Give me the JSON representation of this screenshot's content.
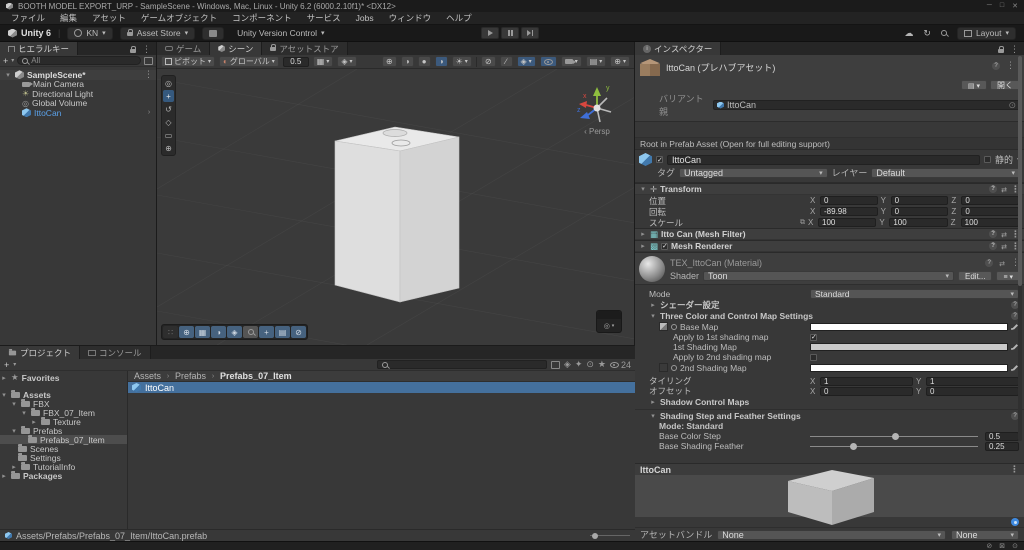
{
  "window": {
    "title": "BOOTH MODEL EXPORT_URP - SampleScene - Windows, Mac, Linux - Unity 6.2 (6000.2.10f1)* <DX12>",
    "menus": [
      "ファイル",
      "編集",
      "アセット",
      "ゲームオブジェクト",
      "コンポーネント",
      "サービス",
      "Jobs",
      "ウィンドウ",
      "ヘルプ"
    ]
  },
  "toolbar": {
    "unity_version": "Unity 6",
    "account": "KN",
    "asset_store": "Asset Store",
    "version_control": "Unity Version Control",
    "layout": "Layout"
  },
  "hierarchy": {
    "tab": "ヒエラルキー",
    "search_placeholder": "All",
    "scene_name": "SampleScene*",
    "items": [
      {
        "label": "Main Camera"
      },
      {
        "label": "Directional Light"
      },
      {
        "label": "Global Volume"
      },
      {
        "label": "IttoCan"
      }
    ]
  },
  "scene": {
    "tab_game": "ゲーム",
    "tab_scene": "シーン",
    "tab_store": "アセットストア",
    "pivot": "ピボット",
    "space": "グローバル",
    "grid_size": "0.5",
    "persp": "‹ Persp",
    "axis": {
      "x": "x",
      "y": "y",
      "z": "z"
    }
  },
  "ui": {
    "axis": {
      "x": "X",
      "y": "Y",
      "z": "Z"
    }
  },
  "inspector": {
    "tab": "インスペクター",
    "title": "IttoCan (プレハブアセット)",
    "open_button": "開く",
    "variant_label": "バリアント 親",
    "variant_value": "IttoCan",
    "root_note": "Root in Prefab Asset (Open for full editing support)",
    "name": "IttoCan",
    "static_label": "静的",
    "tag_label": "タグ",
    "tag_value": "Untagged",
    "layer_label": "レイヤー",
    "layer_value": "Default",
    "transform": {
      "title": "Transform",
      "position_label": "位置",
      "rotation_label": "回転",
      "scale_label": "スケール",
      "position": {
        "x": "0",
        "y": "0",
        "z": "0"
      },
      "rotation": {
        "x": "-89.98",
        "y": "0",
        "z": "0"
      },
      "scale": {
        "x": "100",
        "y": "100",
        "z": "100"
      }
    },
    "mesh_filter_title": "Itto Can (Mesh Filter)",
    "mesh_renderer_title": "Mesh Renderer",
    "material": {
      "title": "TEX_IttoCan (Material)",
      "shader_label": "Shader",
      "shader_value": "Toon",
      "edit_button": "Edit...",
      "mode_label": "Mode",
      "mode_value": "Standard",
      "shader_settings_section": "シェーダー設定",
      "three_color_section": "Three Color and Control Map Settings",
      "base_map_label": "Base Map",
      "apply_1st_label": "Apply to 1st shading map",
      "map_1st_label": "1st Shading Map",
      "apply_2nd_label": "Apply to 2nd shading map",
      "map_2nd_label": "2nd Shading Map",
      "tiling_label": "タイリング",
      "tiling": {
        "x": "1",
        "y": "1"
      },
      "offset_label": "オフセット",
      "offset": {
        "x": "0",
        "y": "0"
      },
      "shadow_section": "Shadow Control Maps",
      "shading_section": "Shading Step and Feather Settings",
      "mode_line": "Mode: Standard",
      "base_color_step_label": "Base Color Step",
      "base_color_step": "0.5",
      "base_feather_label": "Base Shading Feather",
      "base_feather": "0.25",
      "colors": {
        "base_map": "#ffffff",
        "map_1st": "#c9c9c9",
        "map_2nd": "#ffffff"
      }
    },
    "preview": {
      "title": "IttoCan",
      "assetbundle_label": "アセットバンドル",
      "bundle1": "None",
      "bundle2": "None"
    }
  },
  "project": {
    "tab_project": "プロジェクト",
    "tab_console": "コンソール",
    "breadcrumb": [
      "Assets",
      "Prefabs",
      "Prefabs_07_Item"
    ],
    "item": "IttoCan",
    "path": "Assets/Prefabs/Prefabs_07_Item/IttoCan.prefab",
    "hidden_count": "24",
    "tree": [
      {
        "label": "Favorites"
      },
      {
        "label": "Assets"
      },
      {
        "label": "FBX"
      },
      {
        "label": "FBX_07_Item"
      },
      {
        "label": "Texture"
      },
      {
        "label": "Prefabs"
      },
      {
        "label": "Prefabs_07_Item"
      },
      {
        "label": "Scenes"
      },
      {
        "label": "Settings"
      },
      {
        "label": "TutorialInfo"
      },
      {
        "label": "Packages"
      }
    ]
  }
}
